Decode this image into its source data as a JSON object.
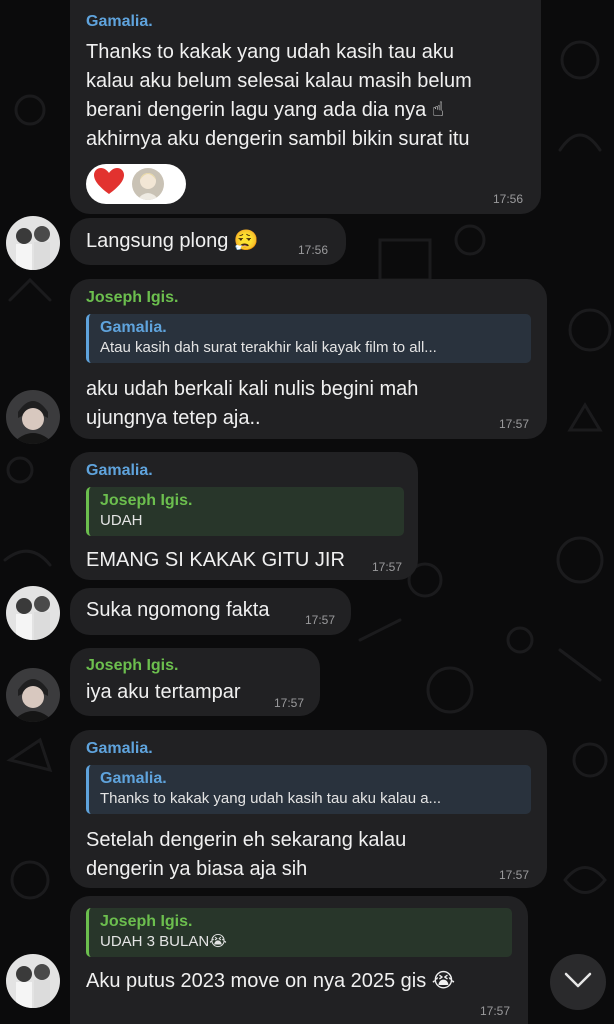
{
  "messages": [
    {
      "sender": "Gamalia.",
      "text": "Thanks to kakak yang udah kasih tau aku\nkalau aku belum selesai kalau masih belum\nberani dengerin lagu yang ada dia nya ☝\nakhirnya aku dengerin sambil bikin surat itu",
      "time": "17:56",
      "reactions": [
        "red-heart",
        "user-avatar"
      ]
    },
    {
      "text": "Langsung plong 😮‍💨",
      "time": "17:56"
    },
    {
      "sender": "Joseph Igis.",
      "reply_name": "Gamalia.",
      "reply_text": "Atau kasih dah surat terakhir kali kayak film to all...",
      "text": "aku udah berkali kali nulis begini mah\nujungnya tetep aja..",
      "time": "17:57"
    },
    {
      "sender": "Gamalia.",
      "reply_name": "Joseph Igis.",
      "reply_text": "UDAH",
      "text": "EMANG SI KAKAK GITU JIR",
      "time": "17:57"
    },
    {
      "text": "Suka ngomong fakta",
      "time": "17:57"
    },
    {
      "sender": "Joseph Igis.",
      "text": "iya aku tertampar",
      "time": "17:57"
    },
    {
      "sender": "Gamalia.",
      "reply_name": "Gamalia.",
      "reply_text": "Thanks to kakak yang udah kasih tau aku kalau a...",
      "text": "Setelah dengerin eh sekarang kalau\ndengerin ya biasa aja sih",
      "time": "17:57"
    },
    {
      "reply_name": "Joseph Igis.",
      "reply_text": "UDAH 3 BULAN😭",
      "text": "Aku putus 2023 move on nya 2025 gis 😭",
      "time": "17:57"
    }
  ],
  "colors": {
    "background": "#0b0b0c",
    "bubble": "#212123",
    "name_blue": "#5fa3dc",
    "name_green": "#6cbf4e",
    "timestamp": "#9a9a9c"
  },
  "icons": [
    "scroll-down-chevron-icon",
    "red-heart-icon"
  ]
}
